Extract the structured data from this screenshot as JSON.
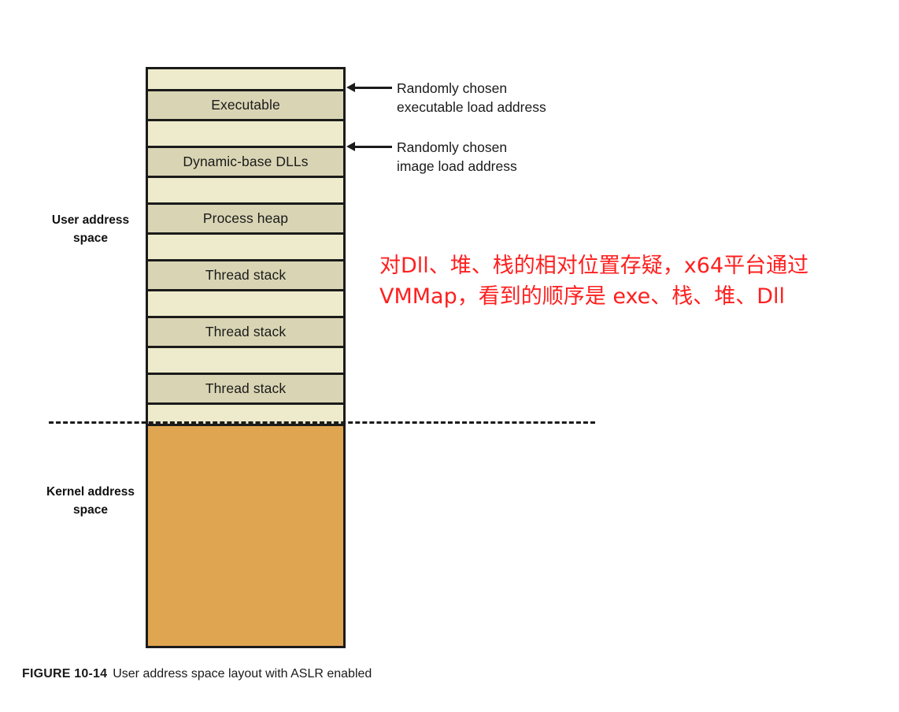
{
  "figure": {
    "caption_number": "FIGURE 10-14",
    "caption_text": "User address space layout with ASLR enabled"
  },
  "colors": {
    "gap_fill": "#EDEBCB",
    "region_fill": "#D9D5B4",
    "kernel_fill": "#E0A551",
    "outline": "#1b1b1b",
    "annotation_red": "#FF1F1F"
  },
  "side_labels": {
    "user": "User\naddress\nspace",
    "kernel": "Kernel\naddress\nspace"
  },
  "diagram": {
    "bands": [
      {
        "kind": "gap",
        "label": ""
      },
      {
        "kind": "region",
        "label": "Executable"
      },
      {
        "kind": "gap",
        "label": ""
      },
      {
        "kind": "region",
        "label": "Dynamic-base DLLs"
      },
      {
        "kind": "gap",
        "label": ""
      },
      {
        "kind": "region",
        "label": "Process heap"
      },
      {
        "kind": "gap",
        "label": ""
      },
      {
        "kind": "region",
        "label": "Thread stack"
      },
      {
        "kind": "gap",
        "label": ""
      },
      {
        "kind": "region",
        "label": "Thread stack"
      },
      {
        "kind": "gap",
        "label": ""
      },
      {
        "kind": "region",
        "label": "Thread stack"
      },
      {
        "kind": "gap",
        "label": ""
      }
    ],
    "kernel_block_label": ""
  },
  "callouts": [
    {
      "id": "executable",
      "text": "Randomly chosen\nexecutable load address",
      "icon": "left-arrow-icon"
    },
    {
      "id": "image",
      "text": "Randomly chosen\nimage load address",
      "icon": "left-arrow-icon"
    }
  ],
  "red_annotation": {
    "text": "对Dll、堆、栈的相对位置存疑，x64平台通过\nVMMap，看到的顺序是 exe、栈、堆、Dll"
  }
}
